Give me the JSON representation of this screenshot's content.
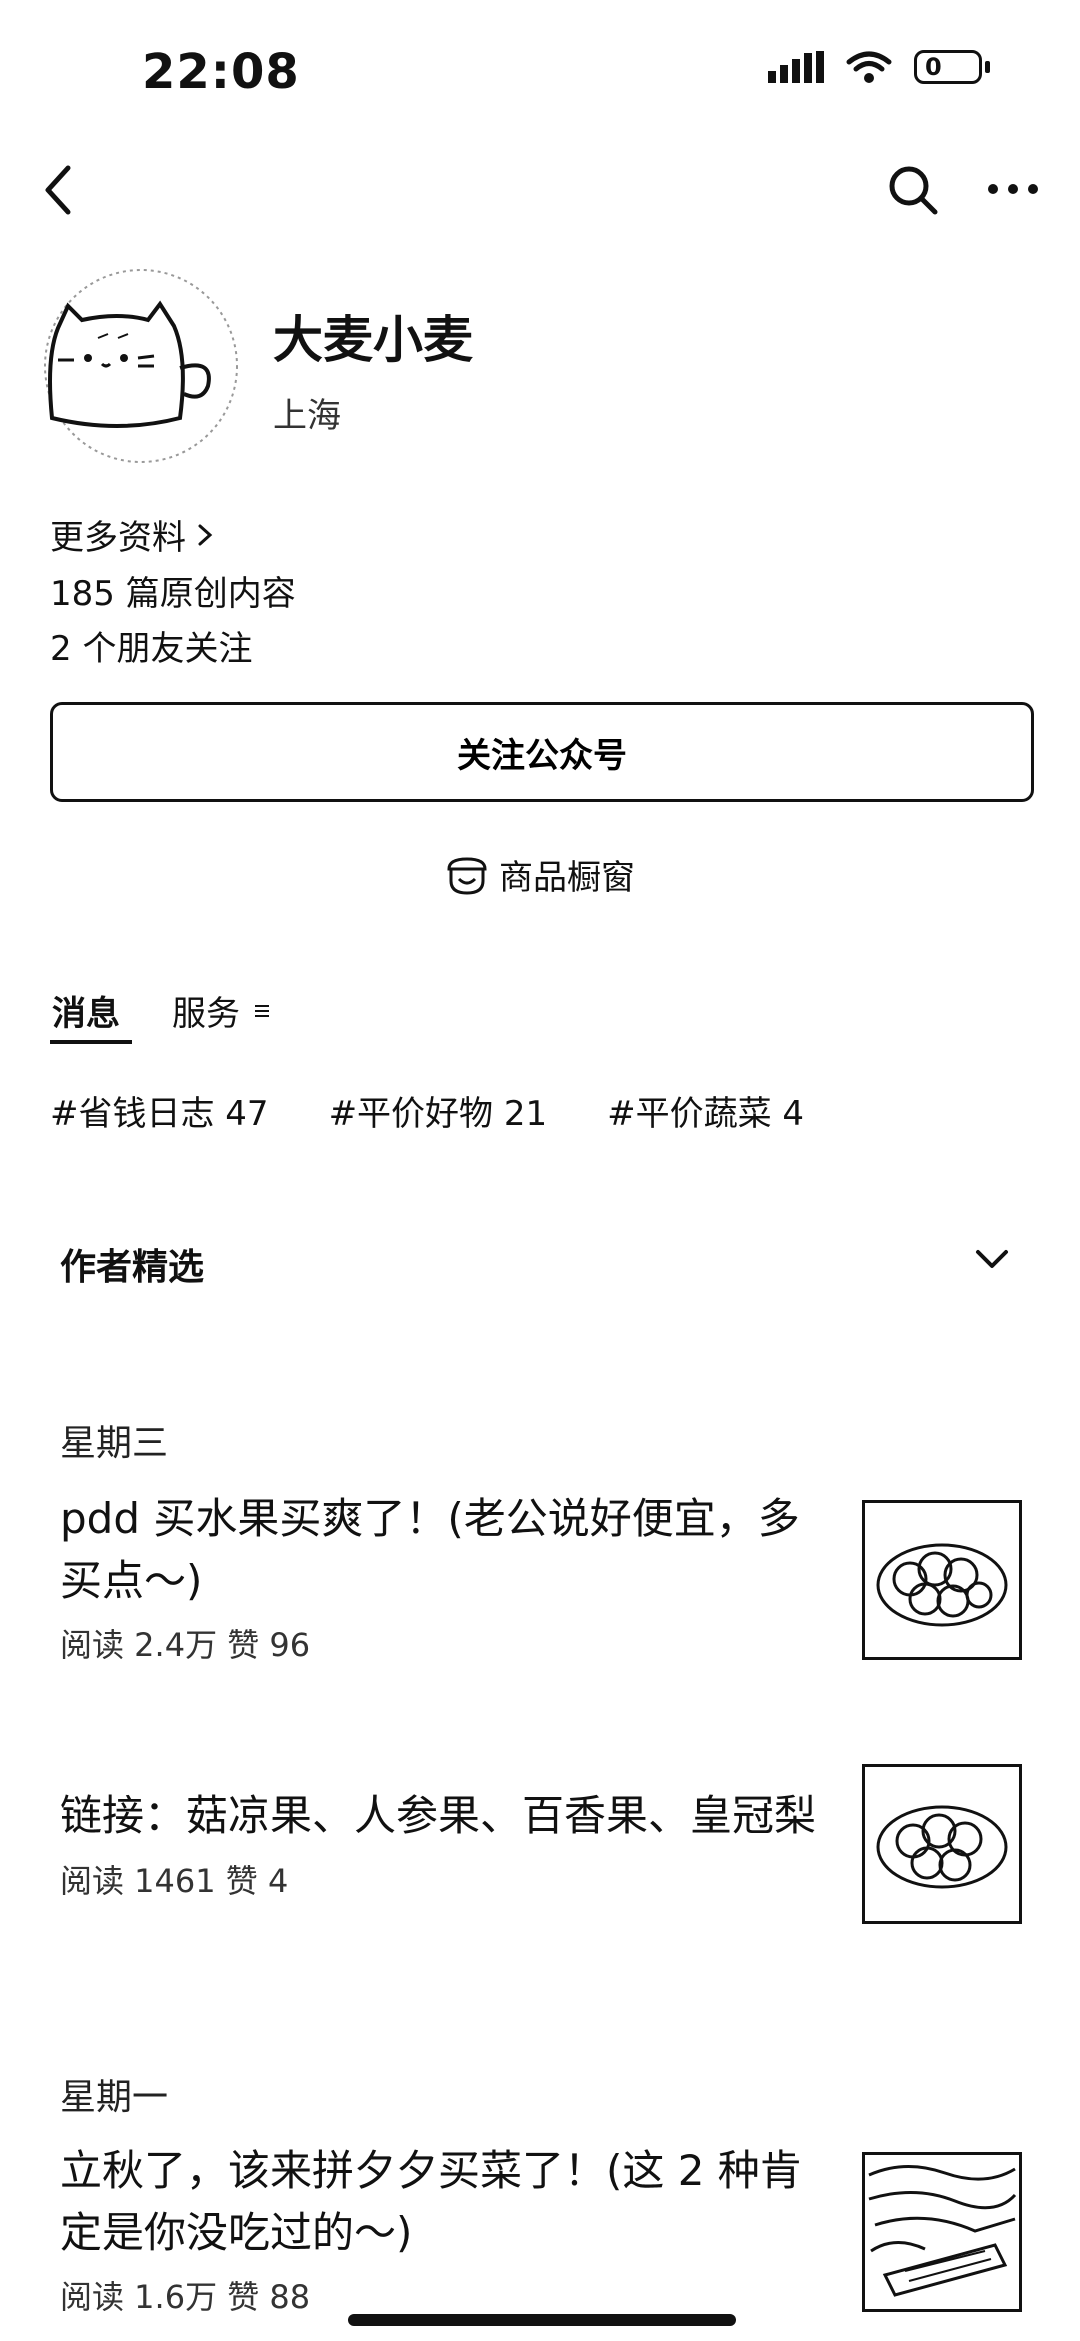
{
  "status_bar": {
    "time": "22:08",
    "battery": "0"
  },
  "profile": {
    "name": "大麦小麦",
    "location": "上海",
    "more_info": "更多资料",
    "articles_count": "185 篇原创内容",
    "friends_follow": "2 个朋友关注"
  },
  "actions": {
    "follow_label": "关注公众号",
    "shop_window_label": "商品橱窗"
  },
  "tabs": {
    "messages": "消息",
    "services": "服务"
  },
  "tags": [
    "#省钱日志 47",
    "#平价好物 21",
    "#平价蔬菜 4"
  ],
  "featured": {
    "label": "作者精选"
  },
  "feed": [
    {
      "day": "星期三",
      "articles": [
        {
          "title": "pdd 买水果买爽了！(老公说好便宜，多买点～)",
          "meta": "阅读 2.4万  赞 96"
        },
        {
          "title": "链接：菇凉果、人参果、百香果、皇冠梨",
          "meta": "阅读 1461  赞 4"
        }
      ]
    },
    {
      "day": "星期一",
      "articles": [
        {
          "title": "立秋了，该来拼夕夕买菜了！(这 2 种肯定是你没吃过的～)",
          "meta": "阅读 1.6万  赞 88"
        }
      ]
    }
  ],
  "colors": {
    "text": "#111111",
    "background": "#ffffff"
  },
  "icons": [
    "signal-icon",
    "wifi-icon",
    "battery-icon",
    "back-icon",
    "search-icon",
    "more-icon",
    "shop-icon",
    "menu-icon",
    "chevron-down-icon",
    "chevron-right-icon"
  ]
}
